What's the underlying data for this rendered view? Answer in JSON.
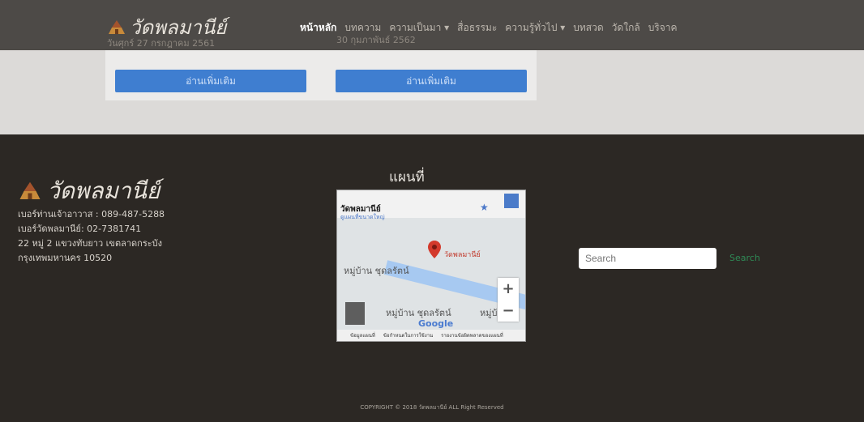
{
  "header": {
    "brand": "วัดพลมานีย์",
    "date_left": "วันศุกร์ 27 กรกฎาคม 2561",
    "date_right": "30 กุมภาพันธ์ 2562",
    "nav": [
      "หน้าหลัก",
      "บทความ",
      "ความเป็นมา ▾",
      "สื่อธรรมะ",
      "ความรู้ทั่วไป ▾",
      "บทสวด",
      "วัดใกล้",
      "บริจาค"
    ]
  },
  "content": {
    "read_more_1": "อ่านเพิ่มเติม",
    "read_more_2": "อ่านเพิ่มเติม"
  },
  "footer": {
    "brand": "วัดพลมานีย์",
    "phone_abbot": "เบอร์ท่านเจ้าอาวาส : 089-487-5288",
    "phone_temple": "เบอร์วัดพลมานีย์: 02-7381741",
    "address_1": "22 หมู่ 2 แขวงทับยาว เขตลาดกระบัง",
    "address_2": "กรุงเทพมหานคร 10520",
    "map_title": "แผนที่",
    "map": {
      "place_name": "วัดพลมานีย์",
      "place_link": "ดูแผนที่ขนาดใหญ่",
      "pin_label": "วัดพลมานีย์",
      "area_1": "หมู่บ้าน ชุดลรัตน์",
      "area_2": "หมู่บ้าน ชุดลรัตน์",
      "area_3": "หมู่บ้าน",
      "zoom_in": "+",
      "zoom_out": "−",
      "google": "Google",
      "footer_links": [
        "ข้อมูลแผนที่",
        "ข้อกำหนดในการใช้งาน",
        "รายงานข้อผิดพลาดของแผนที่"
      ]
    },
    "search_placeholder": "Search",
    "search_button": "Search",
    "copyright": "COPYRIGHT © 2018 วัดพลมานีย์ ALL Right Reserved"
  }
}
